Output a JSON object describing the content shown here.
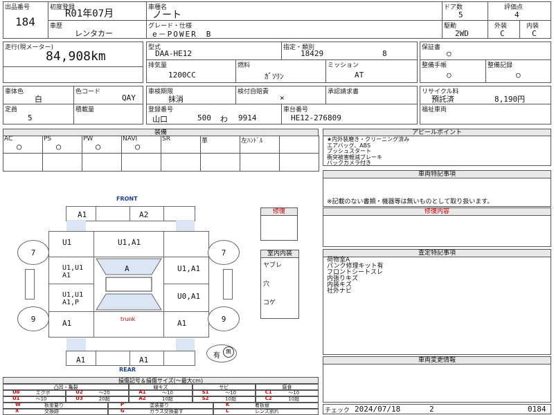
{
  "header": {
    "lot_label": "出品番号",
    "lot": "184",
    "reg_label": "初度登録",
    "reg": "R01年07月",
    "history_label": "車歴",
    "history": "レンタカー",
    "name_label": "車種名",
    "name": "ノート",
    "grade_label": "グレード・仕様",
    "grade": "e－POWER　B",
    "doors_label": "ドア数",
    "doors": "5",
    "drive_label": "駆動",
    "drive": "2WD",
    "score_label": "評価点",
    "score": "4",
    "ext_label": "外装",
    "ext": "C",
    "int_label": "内装",
    "int": "C"
  },
  "row2": {
    "mileage_label": "走行(現メーター)",
    "mileage": "84,908km",
    "model_label": "型式",
    "model": "DAA-HE12",
    "spec_label": "指定・類別",
    "spec_a": "18429",
    "spec_b": "8",
    "warranty_label": "保証書",
    "warranty": "○",
    "disp_label": "排気量",
    "disp": "1200CC",
    "fuel_label": "燃料",
    "fuel": "ｶﾞｿﾘﾝ",
    "mission_label": "ミッション",
    "mission": "AT",
    "manual_label": "整備手帳",
    "manual": "○",
    "record_label": "整備記録",
    "record": "○"
  },
  "row3": {
    "color_label": "車体色",
    "color": "白",
    "code_label": "色コード",
    "code": "QAY",
    "inspect_label": "車検期限",
    "inspect": "抹消",
    "selfcheck_label": "検付自賠責",
    "selfcheck": "×",
    "transfer_label": "承認請求書",
    "recycle_label": "リサイクル料",
    "recycle_status": "預託済",
    "recycle_amount": "8,190円",
    "capacity_label": "定員",
    "capacity": "5",
    "load_label": "積載量",
    "plate_label": "登録番号",
    "plate_area": "山口",
    "plate_num": "500",
    "plate_kana": "わ",
    "plate_no": "9914",
    "chassis_label": "車台番号",
    "chassis": "HE12-276809",
    "welfare_label": "福祉車両"
  },
  "equipment": {
    "title": "装備",
    "cols": [
      "AC",
      "PS",
      "PW",
      "NAVI",
      "SR",
      "革",
      "左ﾊﾝﾄﾞﾙ"
    ],
    "vals": [
      "○",
      "○",
      "○",
      "○",
      "",
      "",
      ""
    ]
  },
  "appeal": {
    "title": "アピールポイント",
    "lines": [
      "★内外装磨き・クリーニング済み",
      "エアバッグ、ABS",
      "プッシュスタート",
      "衝突被害軽減ブレーキ",
      "バックカメラ付き"
    ]
  },
  "special": {
    "title": "車両特記事項",
    "note": "※記載のない書類・機器等は無いものとして取り扱います。"
  },
  "repair": {
    "title": "修復内容",
    "box_label": "修復"
  },
  "inspection": {
    "title": "査定特記事項",
    "lines": [
      "荷物室A",
      "パンク修理キット有",
      "フロントシートスレ",
      "内張りキズ",
      "内装キズ",
      "社外ナビ"
    ]
  },
  "change": {
    "title": "車両変更情報"
  },
  "interior": {
    "title": "室内内装",
    "items": [
      "ヤブレ",
      "穴",
      "コゲ"
    ]
  },
  "car": {
    "front": "FRONT",
    "rear": "REAR",
    "trunk": "trunk",
    "front_left": "A1",
    "front_right": "A2",
    "fl_fender": "U1",
    "hood": "U1,A1",
    "l_front_door": "U1,U1\nA1",
    "r_front_door": "U1,A1",
    "l_rear_door": "U1,U1\nA1,P",
    "r_rear_door": "U0,A1",
    "l_rear_fender": "A1",
    "r_rear_fender": "A1",
    "windshield": "A",
    "rear_left": "A1",
    "rear_right": "A1",
    "tire_fl": "7",
    "tire_fr": "7",
    "tire_rl": "9",
    "tire_rr": "9",
    "spare": "有",
    "spare_circle": "無"
  },
  "legend": {
    "title": "損傷記号＆損傷サイズ(～最大cm)",
    "groups": [
      "凸凹・亀裂",
      "線キズ",
      "サビ",
      "腐食"
    ],
    "rows": [
      [
        [
          "U0",
          "エクボ"
        ],
        [
          "U2",
          "～20"
        ],
        [
          "A1",
          "～10"
        ],
        [
          "S1",
          "～10"
        ],
        [
          "C1",
          "～10"
        ]
      ],
      [
        [
          "U1",
          "～10"
        ],
        [
          "U3",
          "20超"
        ],
        [
          "A2",
          "10超"
        ],
        [
          "S2",
          "10超"
        ],
        [
          "C2",
          "10超"
        ]
      ]
    ],
    "codes": [
      [
        "W",
        "板金要り"
      ],
      [
        "P",
        "塗装要り"
      ],
      [
        "K",
        "着板替"
      ],
      [
        "X",
        "交換跡"
      ],
      [
        "G",
        "ガラス交換要す"
      ],
      [
        "L",
        "レンズ割れ"
      ]
    ]
  },
  "footer": {
    "check_label": "チェック",
    "date": "2024/07/18",
    "num": "2",
    "lot": "0184"
  },
  "colors": {
    "accent": "#cc0000",
    "shade": "#dbe6f5"
  }
}
